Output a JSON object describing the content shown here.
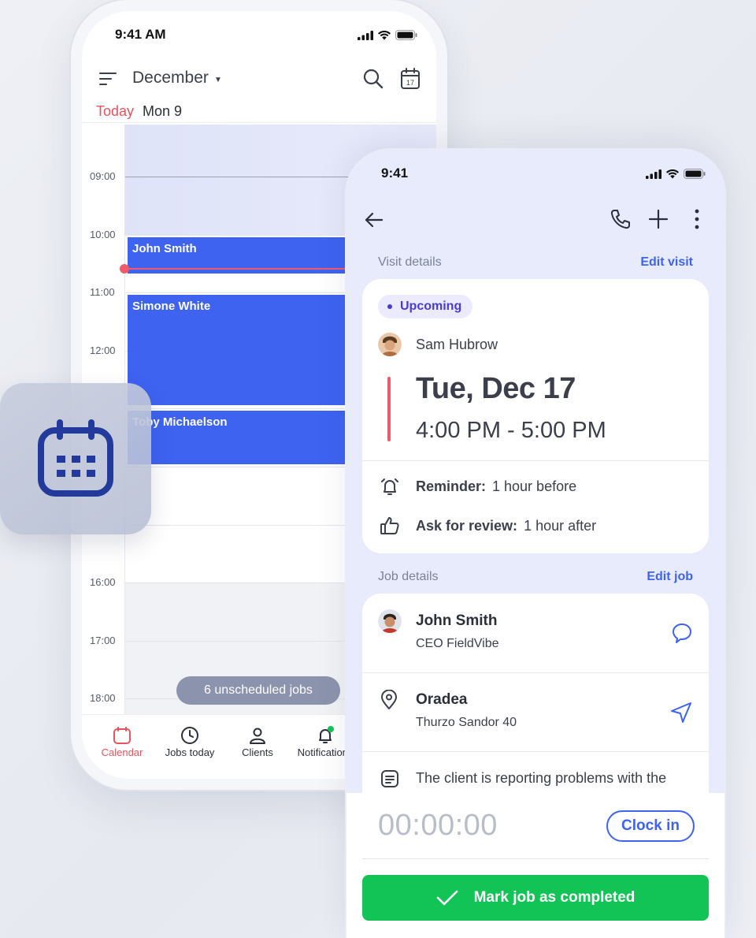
{
  "calendar_app": {
    "status_time": "9:41 AM",
    "month": "December",
    "today_label": "Today",
    "day_label": "Mon 9",
    "hours": [
      "09:00",
      "10:00",
      "11:00",
      "12:00",
      "16:00",
      "17:00",
      "18:00"
    ],
    "events": [
      {
        "title": "John Smith"
      },
      {
        "title": "Simone White"
      },
      {
        "title": "Toby Michaelson"
      }
    ],
    "unscheduled": "6 unscheduled jobs",
    "tabs": [
      {
        "label": "Calendar",
        "icon": "calendar-icon"
      },
      {
        "label": "Jobs today",
        "icon": "clock-icon"
      },
      {
        "label": "Clients",
        "icon": "user-icon"
      },
      {
        "label": "Notifications",
        "icon": "bell-icon"
      }
    ]
  },
  "visit_app": {
    "status_time": "9:41",
    "visit_label": "Visit details",
    "edit_visit": "Edit visit",
    "status": "Upcoming",
    "technician": "Sam Hubrow",
    "date": "Tue, Dec 17",
    "time_range": "4:00 PM - 5:00 PM",
    "reminder_label": "Reminder:",
    "reminder_value": "1 hour before",
    "review_label": "Ask for review:",
    "review_value": "1 hour after",
    "job_label": "Job details",
    "edit_job": "Edit job",
    "client_name": "John Smith",
    "client_role": "CEO FieldVibe",
    "location_name": "Oradea",
    "location_address": "Thurzo Sandor 40",
    "note": "The client is reporting problems with the",
    "timer": "00:00:00",
    "clock_in": "Clock in",
    "complete": "Mark job as completed"
  },
  "colors": {
    "accent_blue": "#3e63f1",
    "today_red": "#e8535d",
    "success_green": "#12c455",
    "upcoming_purple": "#4a3ad8"
  }
}
